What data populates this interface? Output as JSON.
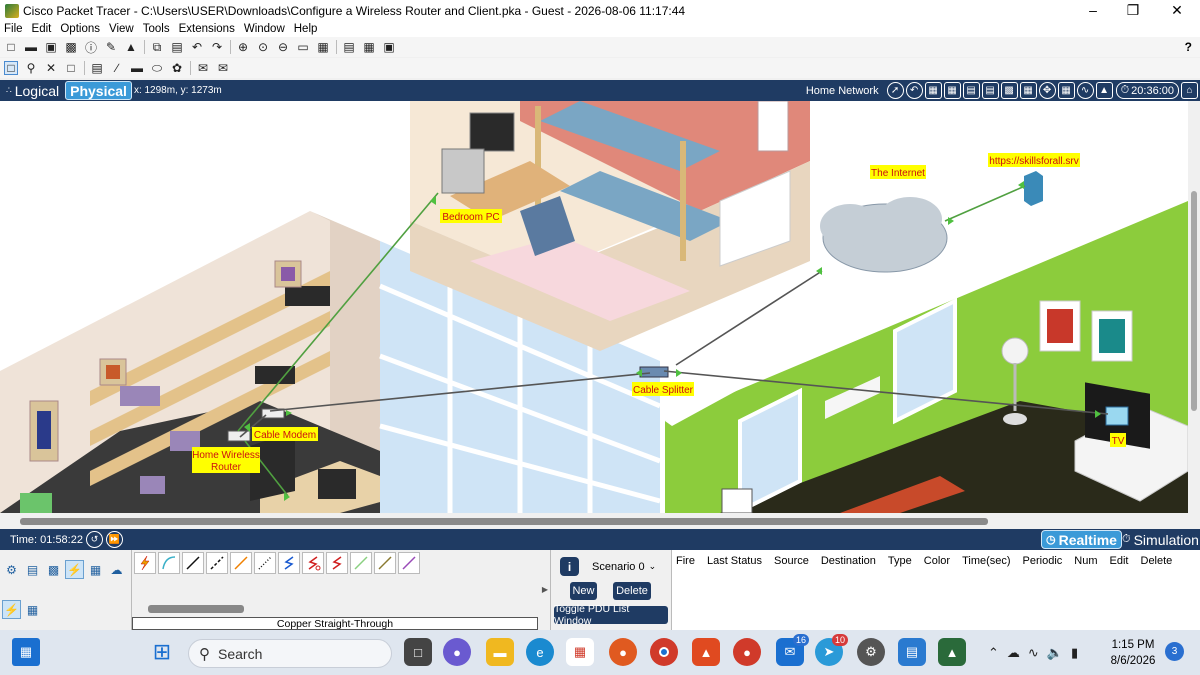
{
  "window": {
    "title": "Cisco Packet Tracer - C:\\Users\\USER\\Downloads\\Configure a Wireless Router and Client.pka - Guest - 2026-08-06 11:17:44",
    "help": "?"
  },
  "menu": [
    "File",
    "Edit",
    "Options",
    "View",
    "Tools",
    "Extensions",
    "Window",
    "Help"
  ],
  "modes": {
    "logical": "Logical",
    "physical": "Physical",
    "coords": "x: 1298m, y: 1273m",
    "location": "Home Network",
    "clock": "20:36:00"
  },
  "workspace": {
    "labels": {
      "bedroom_pc": "Bedroom PC",
      "internet": "The Internet",
      "server": "https://skillsforall.srv",
      "cable_splitter": "Cable Splitter",
      "cable_modem": "Cable Modem",
      "router_line1": "Home Wireless",
      "router_line2": "Router",
      "tv": "TV"
    }
  },
  "timebar": {
    "time": "Time: 01:58:22",
    "realtime": "Realtime",
    "simulation": "Simulation"
  },
  "connections": {
    "selected_label": "Copper Straight-Through"
  },
  "scenario": {
    "select": "Scenario 0",
    "new": "New",
    "delete": "Delete",
    "toggle": "Toggle PDU List Window"
  },
  "pdu_columns": [
    "Fire",
    "Last Status",
    "Source",
    "Destination",
    "Type",
    "Color",
    "Time(sec)",
    "Periodic",
    "Num",
    "Edit",
    "Delete"
  ],
  "taskbar": {
    "search": "Search",
    "badge_mail": "16",
    "badge_telegram": "10",
    "time": "1:15 PM",
    "date": "8/6/2026",
    "notifications": "3"
  }
}
